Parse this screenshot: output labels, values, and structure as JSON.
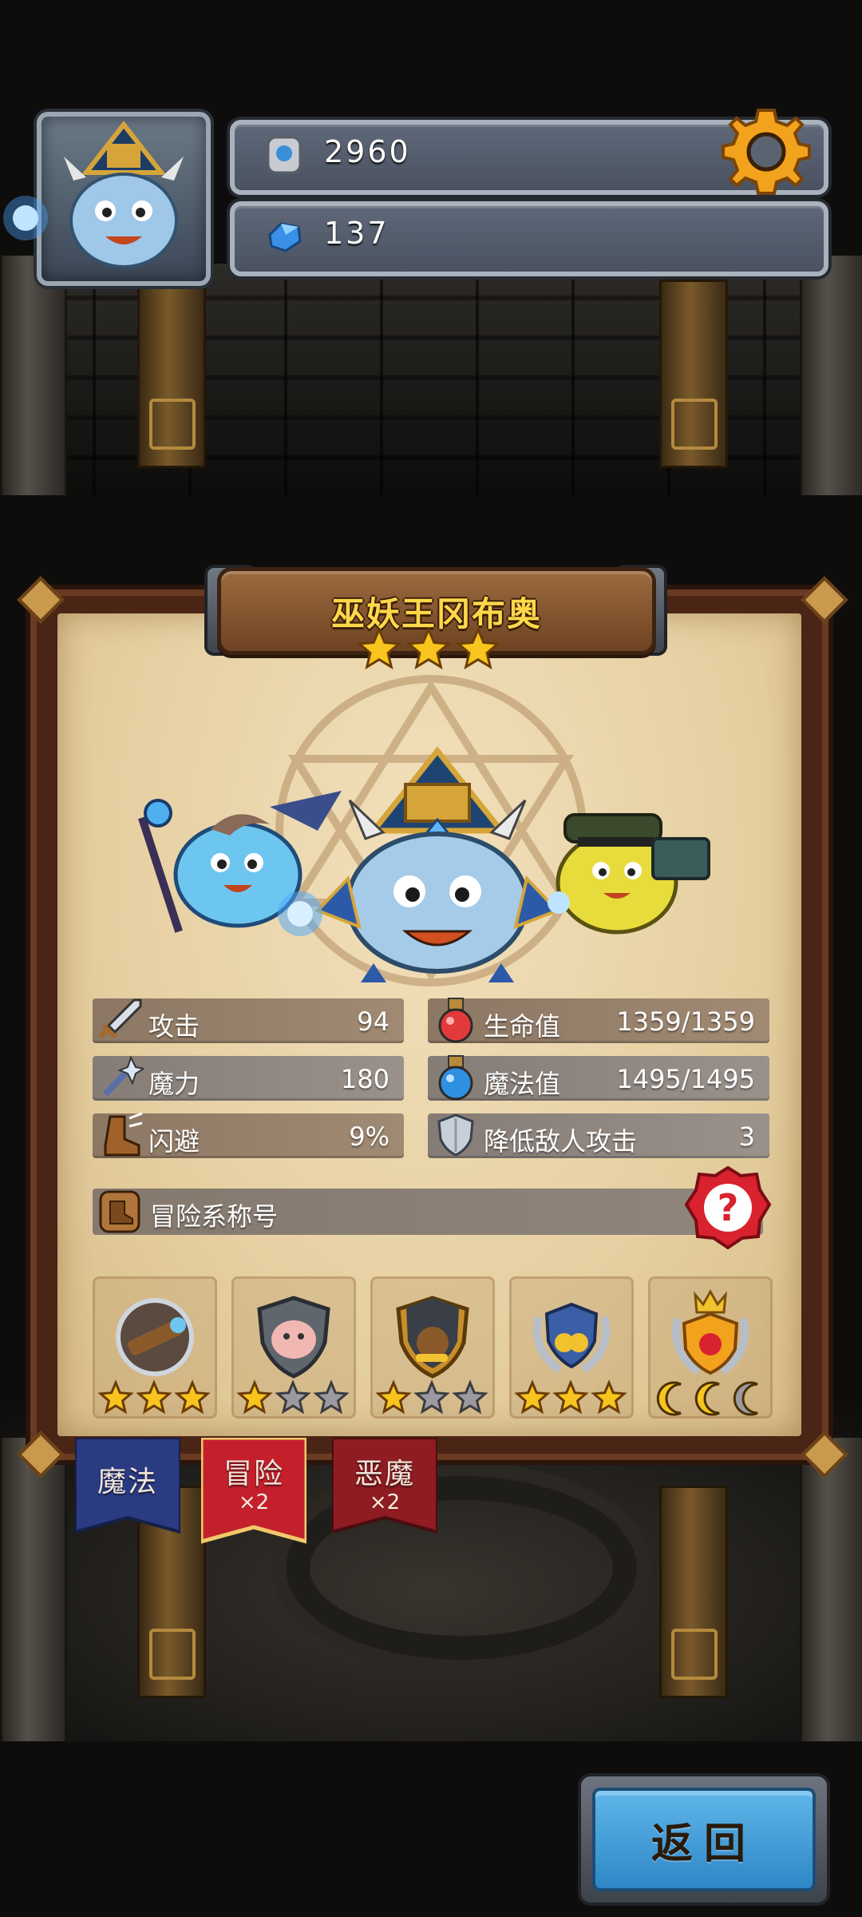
{
  "player": {
    "gold": "2960",
    "gems": "137"
  },
  "card": {
    "name": "巫妖王冈布奥",
    "rarity_stars": 3,
    "stats": [
      {
        "label": "攻击",
        "value": "94",
        "icon": "sword-icon"
      },
      {
        "label": "生命值",
        "value": "1359/1359",
        "icon": "health-potion-icon"
      },
      {
        "label": "魔力",
        "value": "180",
        "icon": "magic-wand-icon"
      },
      {
        "label": "魔法值",
        "value": "1495/1495",
        "icon": "mana-potion-icon"
      },
      {
        "label": "闪避",
        "value": "9%",
        "icon": "boot-icon"
      },
      {
        "label": "降低敌人攻击",
        "value": "3",
        "icon": "shield-icon"
      }
    ],
    "title_bar": {
      "label": "冒险系称号",
      "icon": "adventure-title-icon",
      "help_icon": "question-mark-icon"
    },
    "badges": [
      {
        "icon": "telescope-badge-icon",
        "stars": 3,
        "max": 3
      },
      {
        "icon": "pig-shield-badge-icon",
        "stars": 1,
        "max": 3
      },
      {
        "icon": "treasure-bag-badge-icon",
        "stars": 1,
        "max": 3
      },
      {
        "icon": "gold-laurel-badge-icon",
        "stars": 3,
        "max": 3
      },
      {
        "icon": "crown-trophy-badge-icon",
        "stars": 0,
        "max": 3,
        "moons": 3
      }
    ]
  },
  "tabs": [
    {
      "label": "魔法",
      "multiplier": "",
      "color": "#2a3b82"
    },
    {
      "label": "冒险",
      "multiplier": "×2",
      "color": "#c3202c"
    },
    {
      "label": "恶魔",
      "multiplier": "×2",
      "color": "#8e1c22"
    }
  ],
  "back_label": "返回"
}
